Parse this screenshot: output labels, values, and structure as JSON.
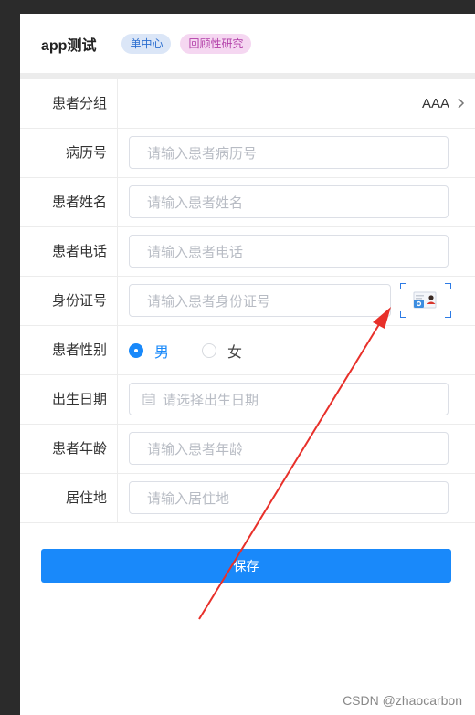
{
  "header": {
    "title": "app测试",
    "tags": [
      "单中心",
      "回顾性研究"
    ]
  },
  "form": {
    "group": {
      "label": "患者分组",
      "value": "AAA"
    },
    "record_no": {
      "label": "病历号",
      "placeholder": "请输入患者病历号"
    },
    "name": {
      "label": "患者姓名",
      "placeholder": "请输入患者姓名"
    },
    "phone": {
      "label": "患者电话",
      "placeholder": "请输入患者电话"
    },
    "id_card": {
      "label": "身份证号",
      "placeholder": "请输入患者身份证号"
    },
    "gender": {
      "label": "患者性别",
      "options": [
        "男",
        "女"
      ],
      "selected": "男"
    },
    "birth": {
      "label": "出生日期",
      "placeholder": "请选择出生日期"
    },
    "age": {
      "label": "患者年龄",
      "placeholder": "请输入患者年龄"
    },
    "address": {
      "label": "居住地",
      "placeholder": "请输入居住地"
    }
  },
  "save_label": "保存",
  "watermark": "CSDN @zhaocarbon",
  "colors": {
    "primary": "#1989fa",
    "annotation_arrow": "#e8302a"
  },
  "icons": {
    "scan": "id-card-scan-icon",
    "calendar": "calendar-icon",
    "chevron": "chevron-right-icon"
  }
}
